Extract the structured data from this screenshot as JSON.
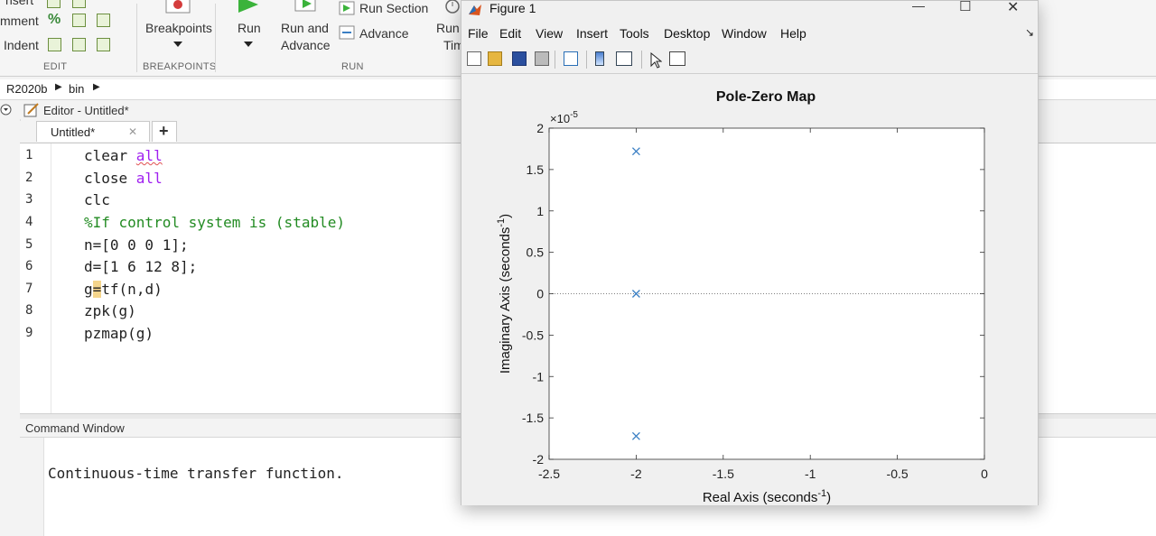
{
  "toolstrip": {
    "partial_insert": "nsert",
    "partial_comment": "mment",
    "percent_symbol": "%",
    "partial_indent": "Indent",
    "section_edit": "EDIT",
    "breakpoints_label": "Breakpoints",
    "section_breakpoints": "BREAKPOINTS",
    "run_label": "Run",
    "run_and_label": "Run and",
    "advance_label": "Advance",
    "run_section_label": "Run Section",
    "advance_small_label": "Advance",
    "run_and_time_partial_1": "Run a",
    "run_and_time_partial_2": "Tim",
    "section_run": "RUN"
  },
  "breadcrumb": {
    "root": "R2020b",
    "folder": "bin"
  },
  "editor": {
    "title": "Editor - Untitled*",
    "tab_label": "Untitled*",
    "tab_close": "✕",
    "add_tab": "+",
    "line_numbers": [
      "1",
      "2",
      "3",
      "4",
      "5",
      "6",
      "7",
      "8",
      "9"
    ],
    "lines": {
      "l1_a": "clear ",
      "l1_b": "all",
      "l2_a": "close ",
      "l2_b": "all",
      "l3": "clc",
      "l4": "%If control system is (stable)",
      "l5": "n=[0 0 0 1];",
      "l6": "d=[1 6 12 8];",
      "l7_a": "g",
      "l7_b": "=",
      "l7_c": "tf(n,d)",
      "l8": "zpk(g)",
      "l9": "pzmap(g)"
    }
  },
  "command_window": {
    "title": "Command Window",
    "output": "Continuous-time transfer function."
  },
  "figure": {
    "title": "Figure 1",
    "menu": [
      "File",
      "Edit",
      "View",
      "Insert",
      "Tools",
      "Desktop",
      "Window",
      "Help"
    ],
    "minimize": "—",
    "maximize": "☐",
    "close": "✕",
    "dock_arrow": "↘"
  },
  "chart_data": {
    "type": "scatter",
    "title": "Pole-Zero Map",
    "xlabel": "Real Axis (seconds",
    "xlabel_sup": "-1",
    "xlabel_end": ")",
    "ylabel": "Imaginary Axis (seconds",
    "ylabel_sup": "-1",
    "ylabel_end": ")",
    "y_exponent": "×10",
    "y_exponent_sup": "-5",
    "xlim": [
      -2.5,
      0
    ],
    "ylim": [
      -2,
      2
    ],
    "x_ticks": [
      -2.5,
      -2,
      -1.5,
      -1,
      -0.5,
      0
    ],
    "x_tick_labels": [
      "-2.5",
      "-2",
      "-1.5",
      "-1",
      "-0.5",
      "0"
    ],
    "y_ticks": [
      -2,
      -1.5,
      -1,
      -0.5,
      0,
      0.5,
      1,
      1.5,
      2
    ],
    "y_tick_labels": [
      "-2",
      "-1.5",
      "-1",
      "-0.5",
      "0",
      "0.5",
      "1",
      "1.5",
      "2"
    ],
    "series": [
      {
        "marker": "x",
        "color": "#3a7fc4",
        "x": [
          -2,
          -2,
          -2
        ],
        "y": [
          1.72,
          0,
          -1.72
        ]
      }
    ],
    "grid": false,
    "zero_line": true
  }
}
